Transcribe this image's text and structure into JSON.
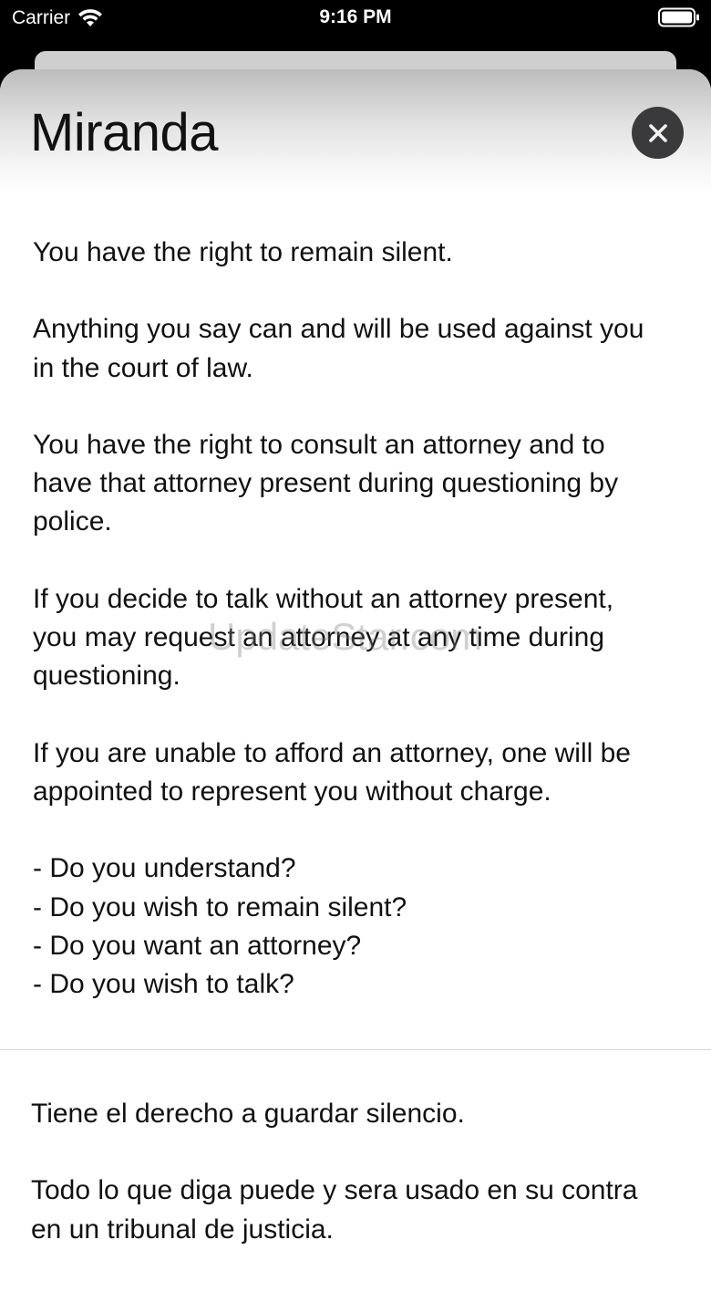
{
  "status_bar": {
    "carrier": "Carrier",
    "time": "9:16 PM",
    "icons": [
      "wifi-icon",
      "battery-icon"
    ]
  },
  "sheet": {
    "title": "Miranda",
    "close_icon": "close-icon"
  },
  "english": {
    "p1": "You have the right to remain silent.",
    "p2_l1": "Anything you say can and will be used against you",
    "p2_l2": "in the court of law.",
    "p3_l1": "You have the right to consult an attorney and to",
    "p3_l2": "have that attorney present during questioning by",
    "p3_l3": "police.",
    "p4_l1": "If you decide to talk without an attorney present,",
    "p4_l2": "you may request an attorney at any time during",
    "p4_l3": "questioning.",
    "p5_l1": "If you are unable to afford an attorney, one will be",
    "p5_l2": "appointed to represent you without charge.",
    "q1": "- Do you understand?",
    "q2": "- Do you wish to remain silent?",
    "q3": "- Do you want an attorney?",
    "q4": "- Do you wish to talk?"
  },
  "spanish": {
    "p1": "Tiene el derecho a guardar silencio.",
    "p2_l1": "Todo lo que diga puede y sera usado en su contra",
    "p2_l2": "en un tribunal de justicia."
  },
  "watermark": "UpdateStar.com",
  "colors": {
    "close_button_bg": "#3a3a3c",
    "text": "#111111",
    "status_bar_bg": "#000000"
  }
}
